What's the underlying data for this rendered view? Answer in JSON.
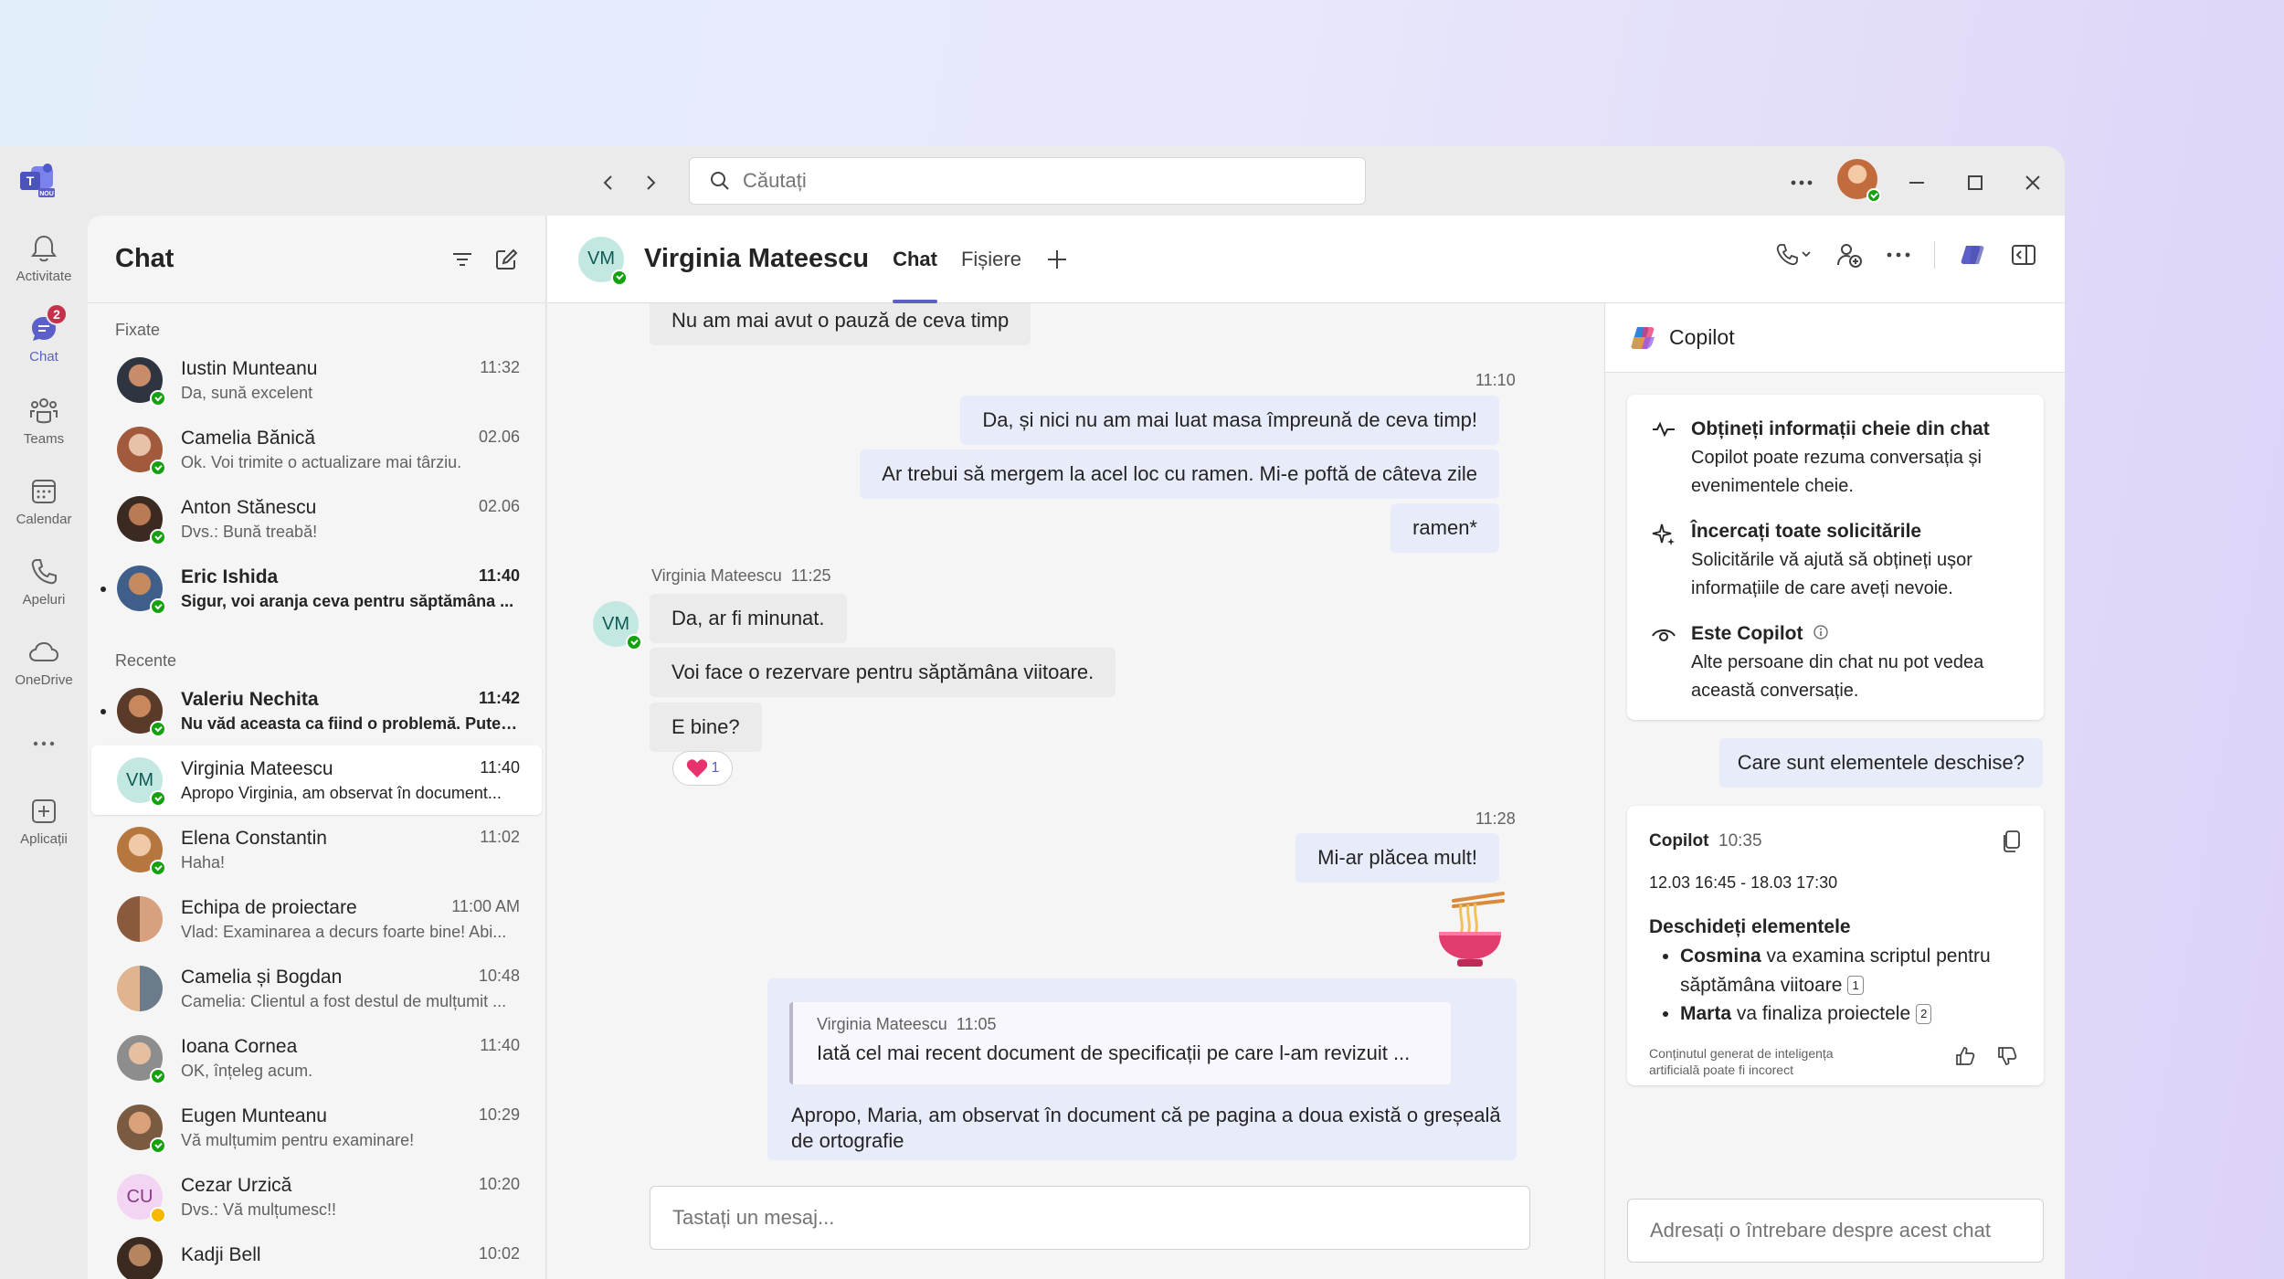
{
  "nav": {
    "back_icon": "chevron-left-icon",
    "forward_icon": "chevron-right-icon"
  },
  "search": {
    "placeholder": "Căutați"
  },
  "logo": {
    "label": "NOU"
  },
  "rail": [
    {
      "label": "Activitate",
      "icon": "bell-icon"
    },
    {
      "label": "Chat",
      "icon": "chat-icon",
      "badge": "2"
    },
    {
      "label": "Teams",
      "icon": "teams-icon"
    },
    {
      "label": "Calendar",
      "icon": "calendar-icon"
    },
    {
      "label": "Apeluri",
      "icon": "phone-icon"
    },
    {
      "label": "OneDrive",
      "icon": "cloud-icon"
    },
    {
      "label": "Aplicații",
      "icon": "add-apps-icon"
    }
  ],
  "list": {
    "title": "Chat",
    "pinned_label": "Fixate",
    "recent_label": "Recente",
    "pinned": [
      {
        "name": "Iustin Munteanu",
        "time": "11:32",
        "preview": "Da, sună excelent"
      },
      {
        "name": "Camelia Bănică",
        "time": "02.06",
        "preview": "Ok. Voi trimite o actualizare mai târziu."
      },
      {
        "name": "Anton Stănescu",
        "time": "02.06",
        "preview": "Dvs.: Bună treabă!"
      },
      {
        "name": "Eric Ishida",
        "time": "11:40",
        "preview": "Sigur, voi aranja ceva pentru săptămâna ..."
      }
    ],
    "recent": [
      {
        "name": "Valeriu Nechita",
        "time": "11:42",
        "preview": "Nu văd aceasta ca fiind o problemă. Puteț..."
      },
      {
        "name": "Virginia Mateescu",
        "time": "11:40",
        "preview": "Apropo Virginia, am observat în document...",
        "initials": "VM"
      },
      {
        "name": "Elena Constantin",
        "time": "11:02",
        "preview": "Haha!"
      },
      {
        "name": "Echipa de proiectare",
        "time": "11:00 AM",
        "preview": "Vlad: Examinarea a decurs foarte bine! Abi..."
      },
      {
        "name": "Camelia și Bogdan",
        "time": "10:48",
        "preview": "Camelia: Clientul a fost destul de mulțumit ..."
      },
      {
        "name": "Ioana Cornea",
        "time": "11:40",
        "preview": "OK, înțeleg acum."
      },
      {
        "name": "Eugen Munteanu",
        "time": "10:29",
        "preview": "Vă mulțumim pentru examinare!"
      },
      {
        "name": "Cezar Urzică",
        "time": "10:20",
        "preview": "Dvs.: Vă mulțumesc!!",
        "initials": "CU"
      },
      {
        "name": "Kadji Bell",
        "time": "10:02",
        "preview": ""
      }
    ]
  },
  "chat": {
    "name": "Virginia Mateescu",
    "initials": "VM",
    "tabs": [
      "Chat",
      "Fișiere"
    ],
    "messages": {
      "m0": "Nu am mai avut o pauză de ceva timp",
      "t1": "11:10",
      "m1": "Da, și nici nu am mai luat masa împreună de ceva timp!",
      "m2": "Ar trebui să mergem la acel loc cu ramen. Mi-e poftă de câteva zile",
      "m3": "ramen*",
      "sender": "Virginia Mateescu",
      "sender_time": "11:25",
      "m4": "Da, ar fi minunat.",
      "m5": "Voi face o rezervare pentru săptămâna viitoare.",
      "m6": "E bine?",
      "reaction_count": "1",
      "t2": "11:28",
      "m7": "Mi-ar plăcea mult!",
      "quote_sender": "Virginia Mateescu",
      "quote_time": "11:05",
      "quote_text": "Iată cel mai recent document de specificații pe care l-am revizuit ...",
      "m8": "Apropo, Maria, am observat în document că pe pagina a doua există o greșeală de ortografie"
    },
    "composer_placeholder": "Tastați un mesaj..."
  },
  "copilot": {
    "title": "Copilot",
    "features": [
      {
        "title": "Obțineți informații cheie din chat",
        "text": "Copilot poate rezuma conversația și evenimentele cheie.",
        "icon": "pulse-icon"
      },
      {
        "title": "Încercați toate solicitările",
        "text": "Solicitările vă ajută să obțineți ușor informațiile de care aveți nevoie.",
        "icon": "sparkle-icon"
      },
      {
        "title": "Este Copilot",
        "text": "Alte persoane din chat nu pot vedea această conversație.",
        "icon": "eye-icon"
      }
    ],
    "user_prompt": "Care sunt elementele deschise?",
    "response": {
      "sender": "Copilot",
      "time": "10:35",
      "range": "12.03 16:45 - 18.03 17:30",
      "heading": "Deschideți elementele",
      "item1_name": "Cosmina",
      "item1_text": " va examina scriptul pentru săptămâna viitoare",
      "item1_ref": "1",
      "item2_name": "Marta",
      "item2_text": " va finaliza proiectele",
      "item2_ref": "2",
      "disclaimer": "Conținutul generat de inteligența artificială poate fi incorect"
    },
    "ask_placeholder": "Adresați o întrebare despre acest chat"
  },
  "colors": {
    "accent": "#5b5fc7",
    "presence": "#13a10e",
    "badge": "#c4314b"
  }
}
